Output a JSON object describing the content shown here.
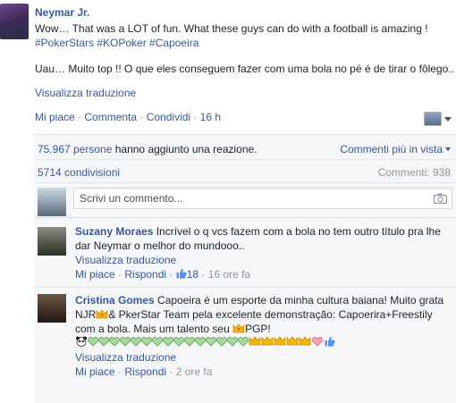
{
  "post": {
    "author": "Neymar Jr.",
    "text_line1": "Wow… That was a LOT of fun. What these guys can do with a football is amazing !",
    "tags": "#PokerStars #KOPoker #Capoeira",
    "text_pt": "Uau… Muito top !! O que eles conseguem fazer com uma bola no pé é de tirar o fôlego..",
    "translate": "Visualizza traduzione",
    "like": "Mi piace",
    "comment": "Commenta",
    "share": "Condividi",
    "time": "16 h",
    "dot": " · "
  },
  "ufi": {
    "reaction_count": "75.967 persone",
    "reaction_rest": " hanno aggiunto una reazione.",
    "best_comments": "Commenti più in vista",
    "shares": "5714 condivisioni",
    "comments": "Commenti: 938",
    "write_placeholder": "Scrivi un commento..."
  },
  "comments": [
    {
      "name": "Suzany Moraes",
      "text": " Incrível o q vcs fazem com a bola no tem outro título pra lhe dar Neymar o melhor do mundooo..",
      "translate": "Visualizza traduzione",
      "like": "Mi piace",
      "reply": "Rispondi",
      "likes": "18",
      "time": "16 ore fa"
    },
    {
      "name": "Cristina Gomes",
      "text": " Capoeira é um esporte da minha cultura baiana! Muito grata",
      "line2a": "NJR",
      "line2b": "& PkerStar Team pela excelente demonstração: Capoerira+Freestily com a bola. Mais um talento seu ",
      "line2c": "PGP!",
      "translate": "Visualizza traduzione",
      "like": "Mi piace",
      "reply": "Rispondi",
      "time": "2 ore fa"
    }
  ],
  "colors": {
    "link": "#365899",
    "meta": "#90949c",
    "panel_bg": "#f6f7f9"
  }
}
